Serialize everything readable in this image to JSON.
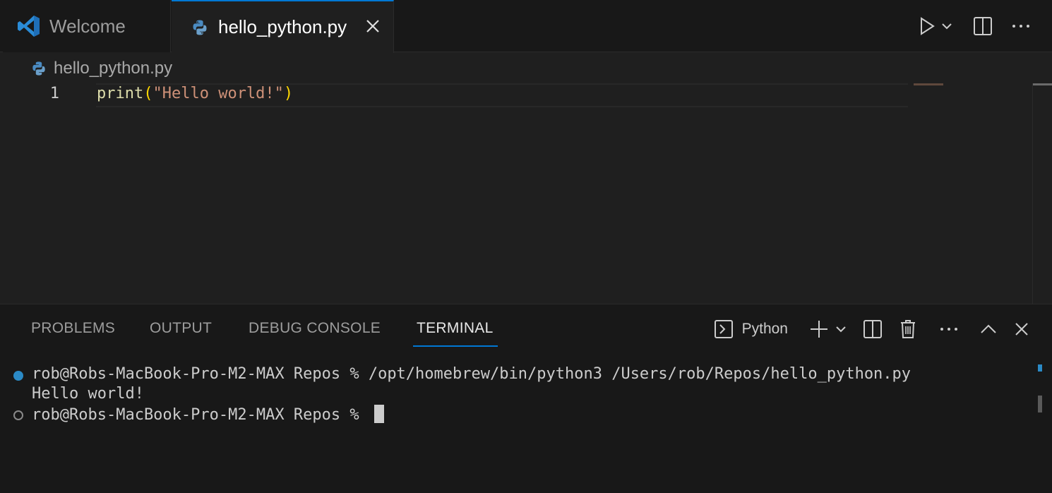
{
  "app": "Visual Studio Code",
  "colors": {
    "accent": "#0078d4",
    "string": "#ce9178",
    "function": "#dcdcaa",
    "bracket": "#ffd700",
    "success_decoration": "#2b8ac6"
  },
  "tabs": [
    {
      "label": "Welcome",
      "icon": "vscode-logo-icon",
      "active": false
    },
    {
      "label": "hello_python.py",
      "icon": "python-file-icon",
      "active": true
    }
  ],
  "tabbar_actions": [
    "run-python-file-icon",
    "chevron-down-icon",
    "split-editor-icon",
    "more-actions-icon"
  ],
  "breadcrumb": {
    "file": "hello_python.py"
  },
  "editor": {
    "lines": [
      {
        "number": "1",
        "fn": "print",
        "open": "(",
        "string": "\"Hello world!\"",
        "close": ")"
      }
    ]
  },
  "panel": {
    "tabs": [
      "PROBLEMS",
      "OUTPUT",
      "DEBUG CONSOLE",
      "TERMINAL"
    ],
    "active_tab": "TERMINAL",
    "terminal_profile": "Python",
    "actions": [
      "new-terminal-icon",
      "chevron-down-icon",
      "split-terminal-icon",
      "trash-icon",
      "more-actions-icon",
      "maximize-panel-icon",
      "close-panel-icon"
    ]
  },
  "terminal": {
    "line1": "rob@Robs-MacBook-Pro-M2-MAX Repos % /opt/homebrew/bin/python3 /Users/rob/Repos/hello_python.py",
    "line2": "Hello world!",
    "line3": "rob@Robs-MacBook-Pro-M2-MAX Repos % "
  }
}
